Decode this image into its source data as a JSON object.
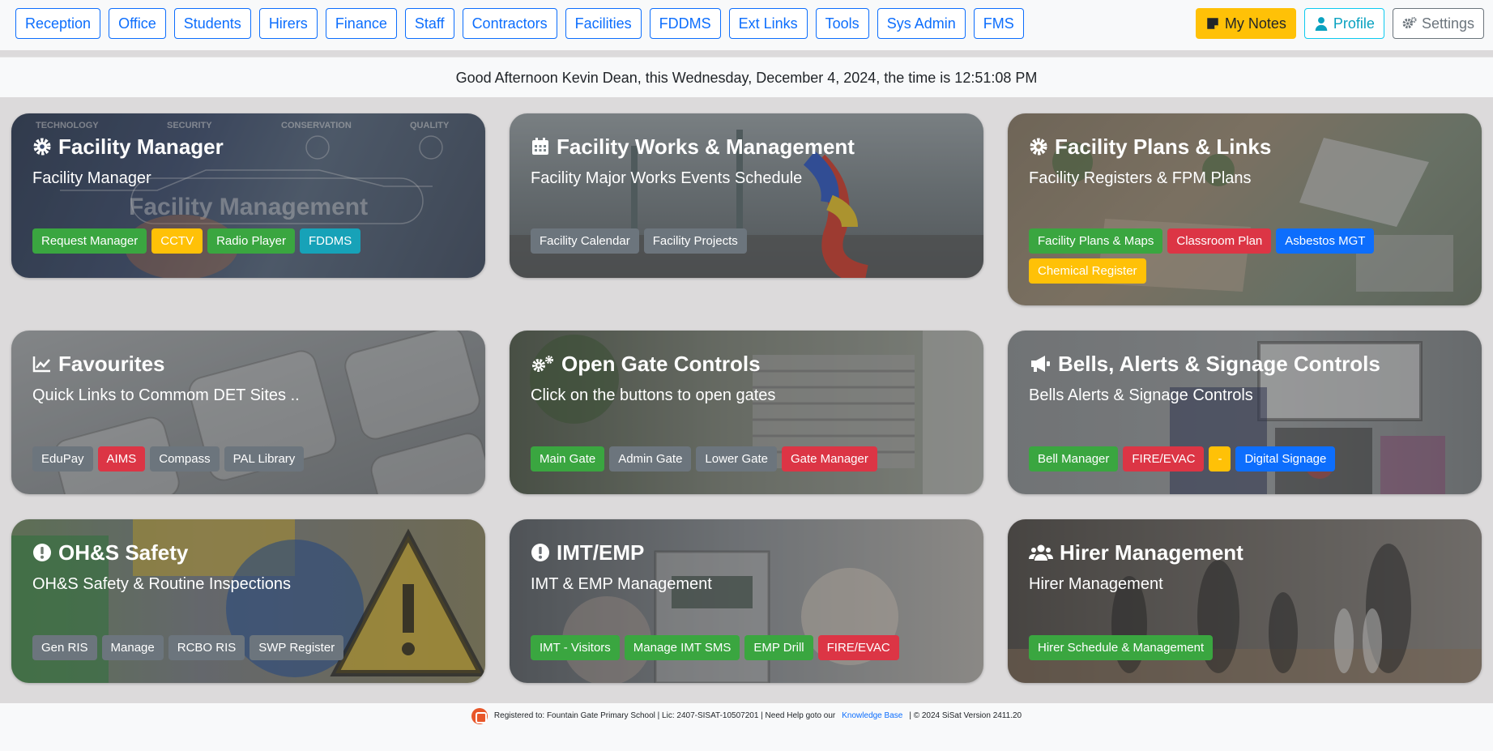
{
  "nav": {
    "left": [
      "Reception",
      "Office",
      "Students",
      "Hirers",
      "Finance",
      "Staff",
      "Contractors",
      "Facilities",
      "FDDMS",
      "Ext Links",
      "Tools",
      "Sys Admin",
      "FMS"
    ],
    "notes": "My Notes",
    "profile": "Profile",
    "settings": "Settings"
  },
  "greeting": "Good Afternoon Kevin Dean, this Wednesday, December 4, 2024, the time is 12:51:08 PM",
  "cards": [
    {
      "title": "Facility Manager",
      "subtitle": "Facility Manager",
      "icon": "gear-icon",
      "buttons": [
        {
          "label": "Request Manager",
          "color": "green"
        },
        {
          "label": "CCTV",
          "color": "yellow"
        },
        {
          "label": "Radio Player",
          "color": "green"
        },
        {
          "label": "FDDMS",
          "color": "cyan"
        }
      ],
      "bg_text": {
        "tech": "TECHNOLOGY",
        "security": "SECURITY",
        "conservation": "CONSERVATION",
        "quality": "QUALITY",
        "banner": "Facility Management"
      }
    },
    {
      "title": "Facility Works & Management",
      "subtitle": "Facility Major Works Events Schedule",
      "icon": "calendar-icon",
      "buttons": [
        {
          "label": "Facility Calendar",
          "color": "gray"
        },
        {
          "label": "Facility Projects",
          "color": "gray"
        }
      ]
    },
    {
      "title": "Facility Plans & Links",
      "subtitle": "Facility Registers & FPM Plans",
      "icon": "gear-icon",
      "buttons": [
        {
          "label": "Facility Plans & Maps",
          "color": "green"
        },
        {
          "label": "Classroom Plan",
          "color": "red"
        },
        {
          "label": "Asbestos MGT",
          "color": "blue"
        },
        {
          "label": "Chemical Register",
          "color": "yellow"
        }
      ]
    },
    {
      "title": "Favourites",
      "subtitle": "Quick Links to Commom DET Sites ..",
      "icon": "chart-line-icon",
      "buttons": [
        {
          "label": "EduPay",
          "color": "gray"
        },
        {
          "label": "AIMS",
          "color": "red"
        },
        {
          "label": "Compass",
          "color": "gray"
        },
        {
          "label": "PAL Library",
          "color": "gray"
        }
      ]
    },
    {
      "title": "Open Gate Controls",
      "subtitle": "Click on the buttons to open gates",
      "icon": "gears-icon",
      "buttons": [
        {
          "label": "Main Gate",
          "color": "green"
        },
        {
          "label": "Admin Gate",
          "color": "gray"
        },
        {
          "label": "Lower Gate",
          "color": "gray"
        },
        {
          "label": "Gate Manager",
          "color": "red"
        }
      ]
    },
    {
      "title": "Bells, Alerts & Signage Controls",
      "subtitle": "Bells Alerts & Signage Controls",
      "icon": "megaphone-icon",
      "buttons": [
        {
          "label": "Bell Manager",
          "color": "green"
        },
        {
          "label": "FIRE/EVAC",
          "color": "red"
        },
        {
          "label": "-",
          "color": "yellow"
        },
        {
          "label": "Digital Signage",
          "color": "blue"
        }
      ]
    },
    {
      "title": "OH&S Safety",
      "subtitle": "OH&S Safety & Routine Inspections",
      "icon": "exclamation-circle-icon",
      "buttons": [
        {
          "label": "Gen RIS",
          "color": "gray"
        },
        {
          "label": "Manage",
          "color": "gray"
        },
        {
          "label": "RCBO RIS",
          "color": "gray"
        },
        {
          "label": "SWP Register",
          "color": "gray"
        }
      ]
    },
    {
      "title": "IMT/EMP",
      "subtitle": "IMT & EMP Management",
      "icon": "exclamation-circle-icon",
      "buttons": [
        {
          "label": "IMT - Visitors",
          "color": "green"
        },
        {
          "label": "Manage IMT SMS",
          "color": "green"
        },
        {
          "label": "EMP Drill",
          "color": "green"
        },
        {
          "label": "FIRE/EVAC",
          "color": "red"
        }
      ]
    },
    {
      "title": "Hirer Management",
      "subtitle": "Hirer Management",
      "icon": "users-icon",
      "buttons": [
        {
          "label": "Hirer Schedule & Management",
          "color": "green"
        }
      ]
    }
  ],
  "footer": {
    "text": "Registered to: Fountain Gate Primary School | Lic: 2407-SISAT-10507201 | Need Help goto our",
    "link": "Knowledge Base",
    "suffix": "| © 2024 SiSat Version 2411.20"
  }
}
